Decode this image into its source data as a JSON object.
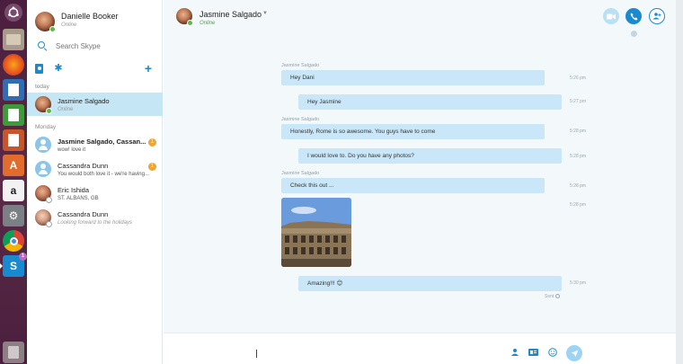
{
  "profile": {
    "name": "Danielle Booker",
    "status": "Online"
  },
  "search": {
    "placeholder": "Search Skype"
  },
  "sections": {
    "today": "today",
    "monday": "Monday"
  },
  "conversations": [
    {
      "name": "Jasmine Salgado",
      "message": "Online",
      "selected": true
    },
    {
      "name": "Jasmine Salgado, Cassan...",
      "message": "wow! love it",
      "unread": "1"
    },
    {
      "name": "Cassandra Dunn",
      "message": "You would both love it - we're having...",
      "unread": "1"
    },
    {
      "name": "Eric Ishida",
      "message": "ST. ALBANS, GB"
    },
    {
      "name": "Cassandra Dunn",
      "message": "Looking forward to the holidays"
    }
  ],
  "chat_header": {
    "name": "Jasmine Salgado",
    "status": "Online"
  },
  "messages": [
    {
      "sender": "Jasmine Salgado",
      "text": "Hey Dani",
      "time": "5:26 pm"
    },
    {
      "text": "Hey Jasmine",
      "time": "5:27 pm"
    },
    {
      "sender": "Jasmine Salgado",
      "text": "Honestly, Rome is so awesome. You guys have to come",
      "time": "5:28 pm"
    },
    {
      "text": "I would love to. Do you have any photos?",
      "time": "5:28 pm"
    },
    {
      "sender": "Jasmine Salgado",
      "text": "Check this out ...",
      "time": "5:28 pm"
    },
    {
      "photo_time": "5:28 pm"
    },
    {
      "text": "Amazing!!! 😊",
      "time": "5:30 pm"
    }
  ],
  "sent_label": "Sent",
  "launcher_badge": "1",
  "colors": {
    "skype_blue": "#1a8ad0",
    "bubble": "#c9e7f8",
    "selected": "#c5e6f5",
    "unread": "#f0a431",
    "online": "#5bb84a"
  }
}
